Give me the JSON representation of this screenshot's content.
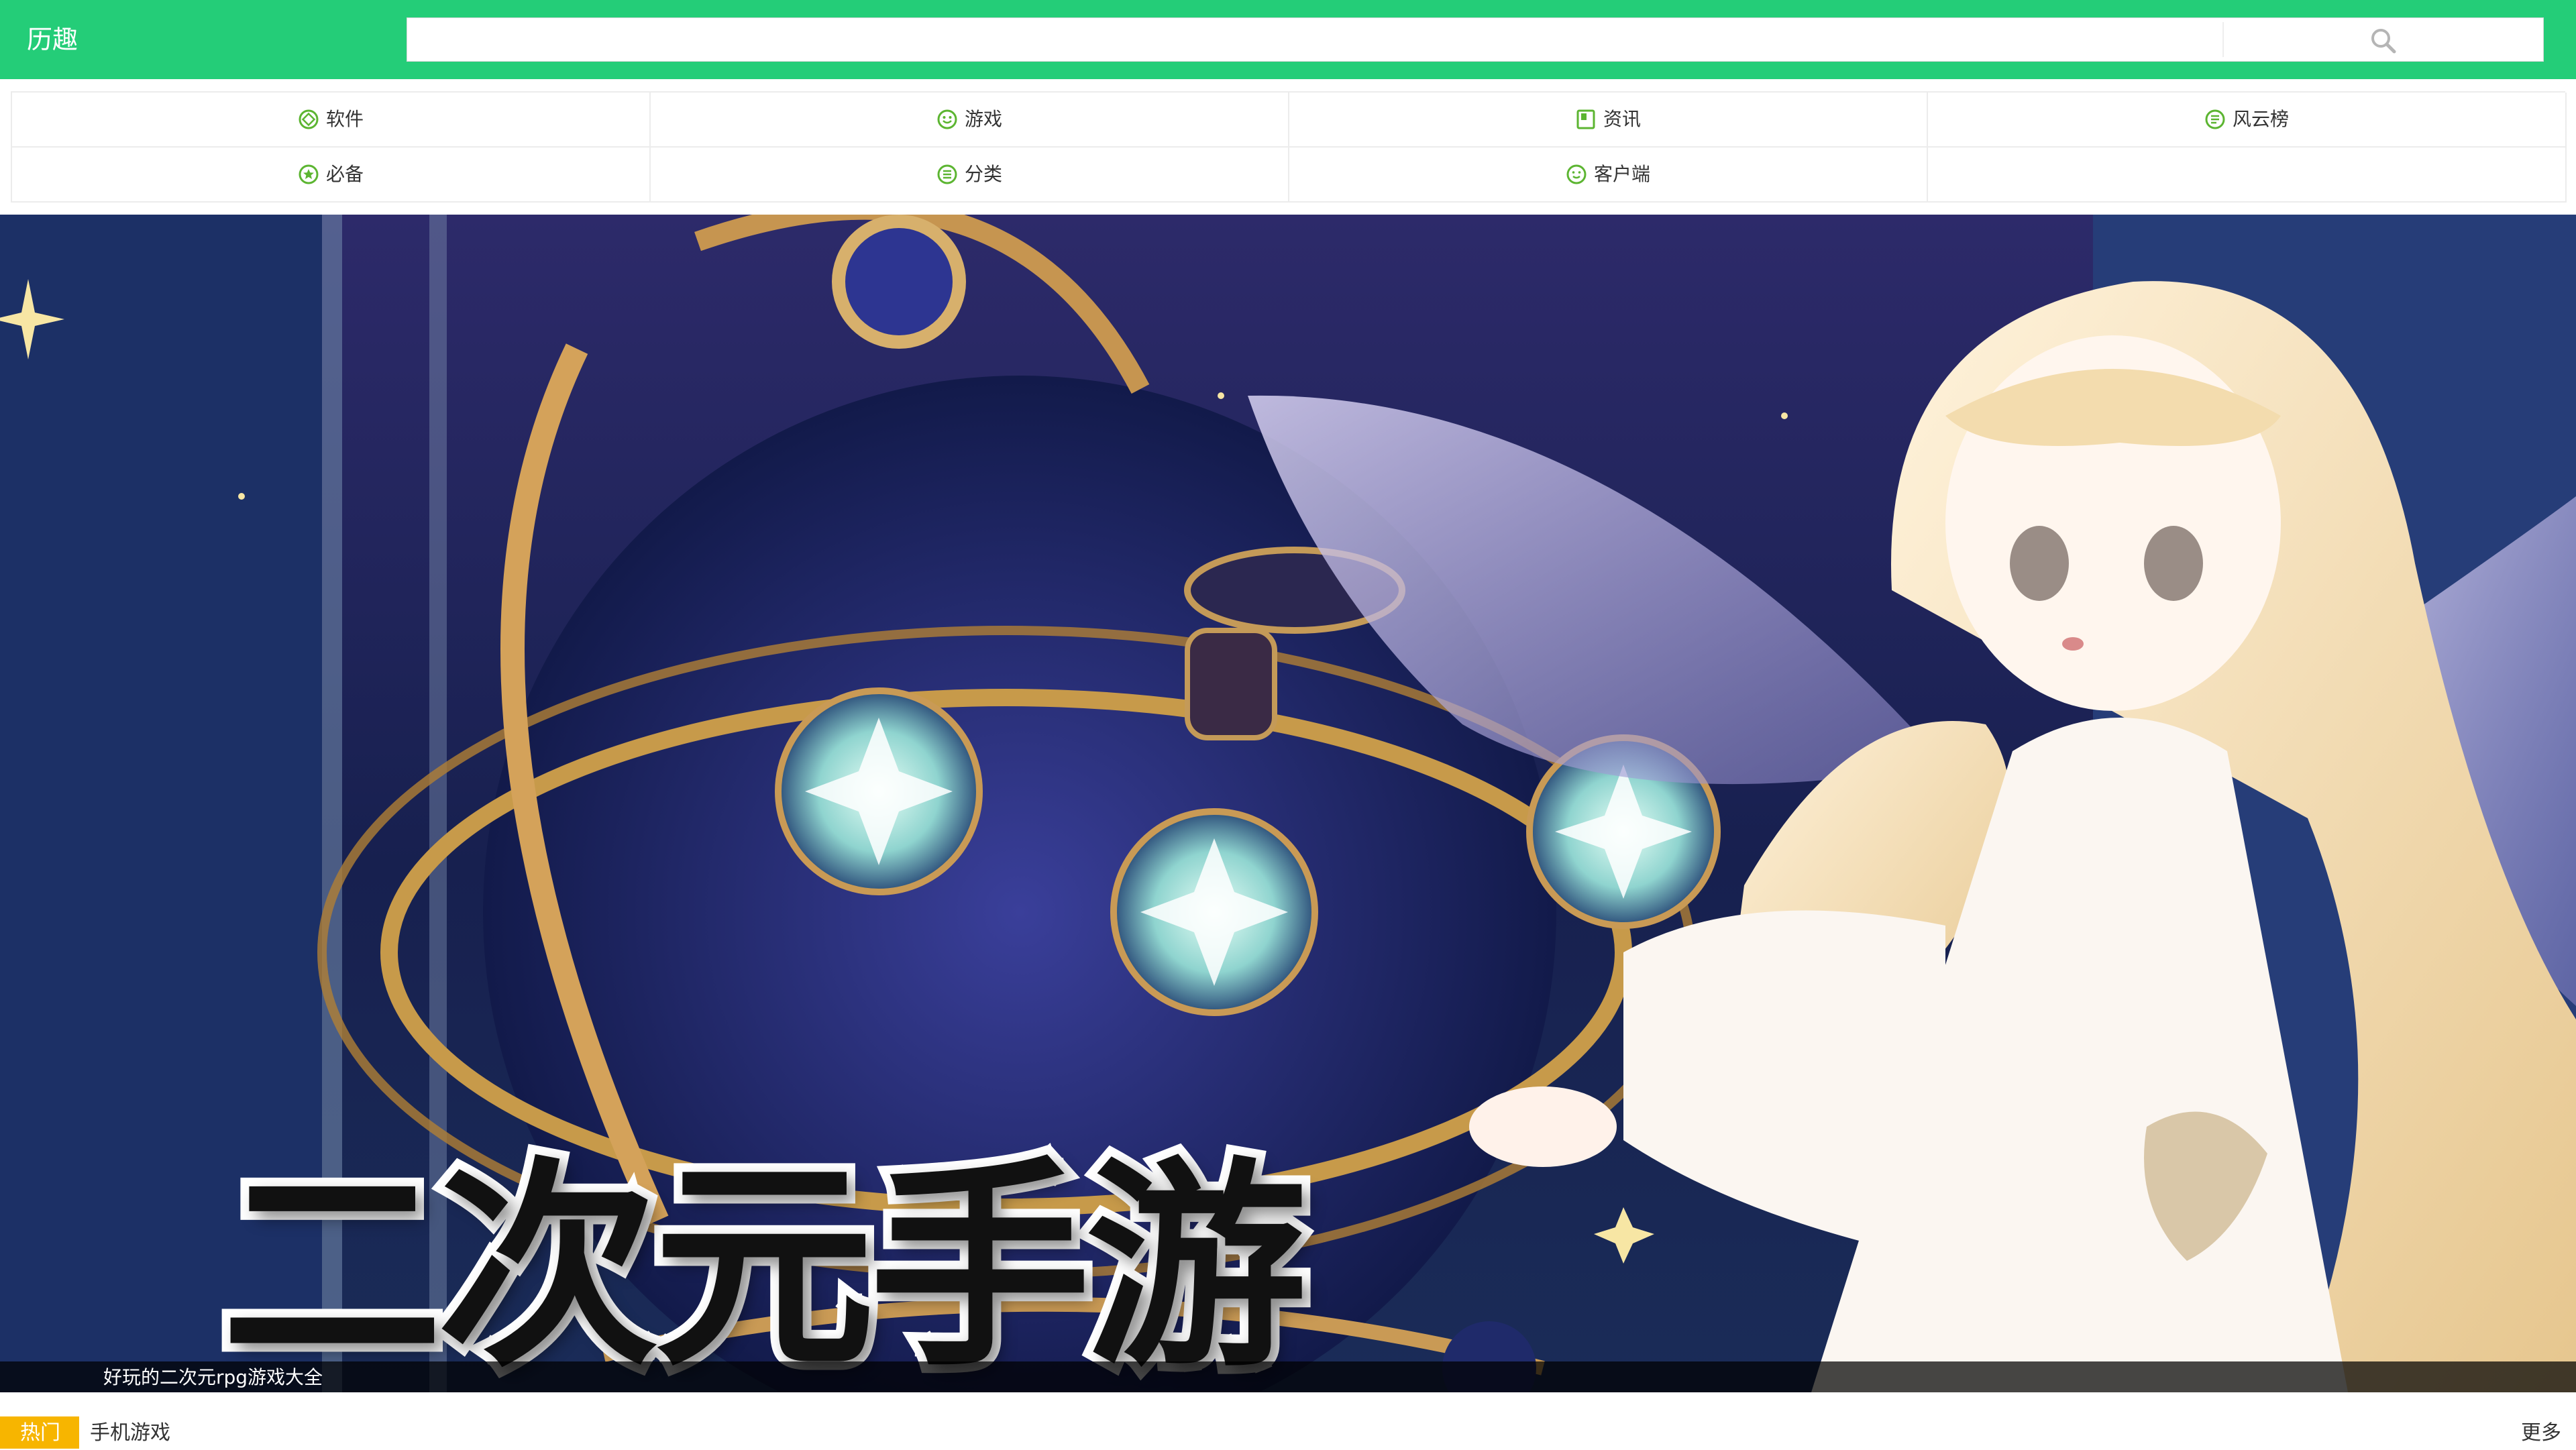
{
  "header": {
    "title": "历趣",
    "background_color": "#24cd78",
    "search": {
      "value": "",
      "placeholder": "",
      "button_icon": "search-icon"
    }
  },
  "nav": {
    "icon_color": "#5cb531",
    "items": [
      {
        "label": "软件",
        "icon": "software-icon"
      },
      {
        "label": "游戏",
        "icon": "smiley-icon"
      },
      {
        "label": "资讯",
        "icon": "news-icon"
      },
      {
        "label": "风云榜",
        "icon": "list-icon"
      },
      {
        "label": "必备",
        "icon": "star-icon"
      },
      {
        "label": "分类",
        "icon": "category-icon"
      },
      {
        "label": "客户端",
        "icon": "client-icon"
      },
      {
        "label": "",
        "icon": ""
      }
    ]
  },
  "banner": {
    "headline": "二次元手游",
    "caption": "好玩的二次元rpg游戏大全"
  },
  "bottom": {
    "hot_label": "热门",
    "hot_color": "#f7b500",
    "tab_label": "手机游戏",
    "more_label": "更多"
  }
}
